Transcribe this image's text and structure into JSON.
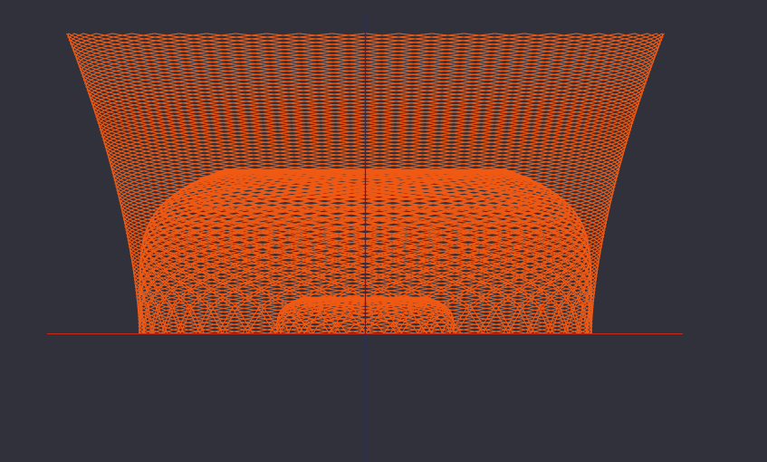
{
  "viewport": {
    "background_color": "#30313a"
  },
  "scene": {
    "mesh_color": "#f05a14",
    "vertical_axis_color": "#1a22c8",
    "horizontal_axis_color": "#c82a1a",
    "outer_mesh": {
      "strands": 56,
      "twists": 3.0
    },
    "middle_mesh": {
      "strands": 46,
      "twists": 2.4
    },
    "inner_mesh": {
      "strands": 30,
      "twists": 1.6
    }
  }
}
